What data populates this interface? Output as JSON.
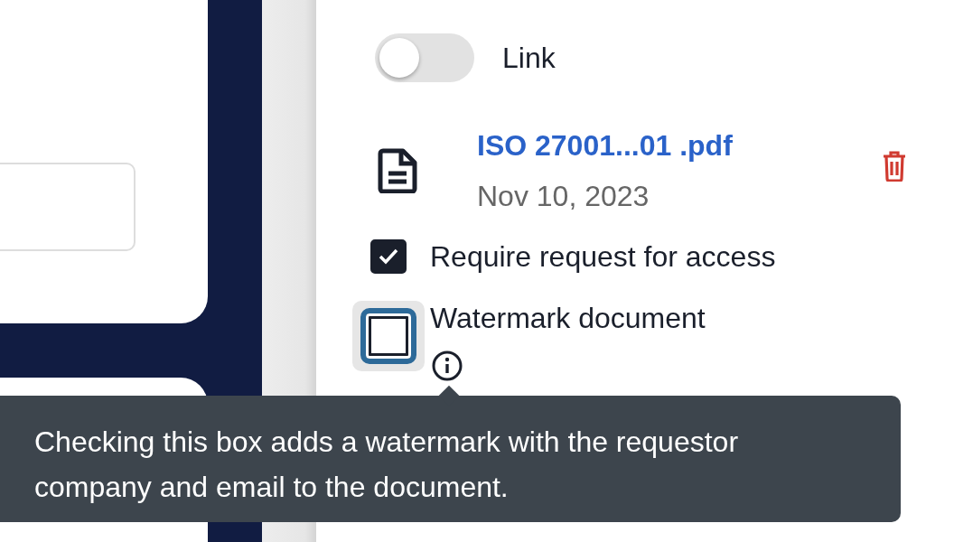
{
  "toggle": {
    "label": "Link",
    "on": false
  },
  "file": {
    "name": "ISO 27001...01 .pdf",
    "date": "Nov 10, 2023"
  },
  "options": [
    {
      "label": "Require request for access",
      "checked": true,
      "focused": false,
      "info": false
    },
    {
      "label": "Watermark document",
      "checked": false,
      "focused": true,
      "info": true
    }
  ],
  "tooltip": {
    "text": "Checking this box adds a watermark with the requestor company and email to the document."
  }
}
